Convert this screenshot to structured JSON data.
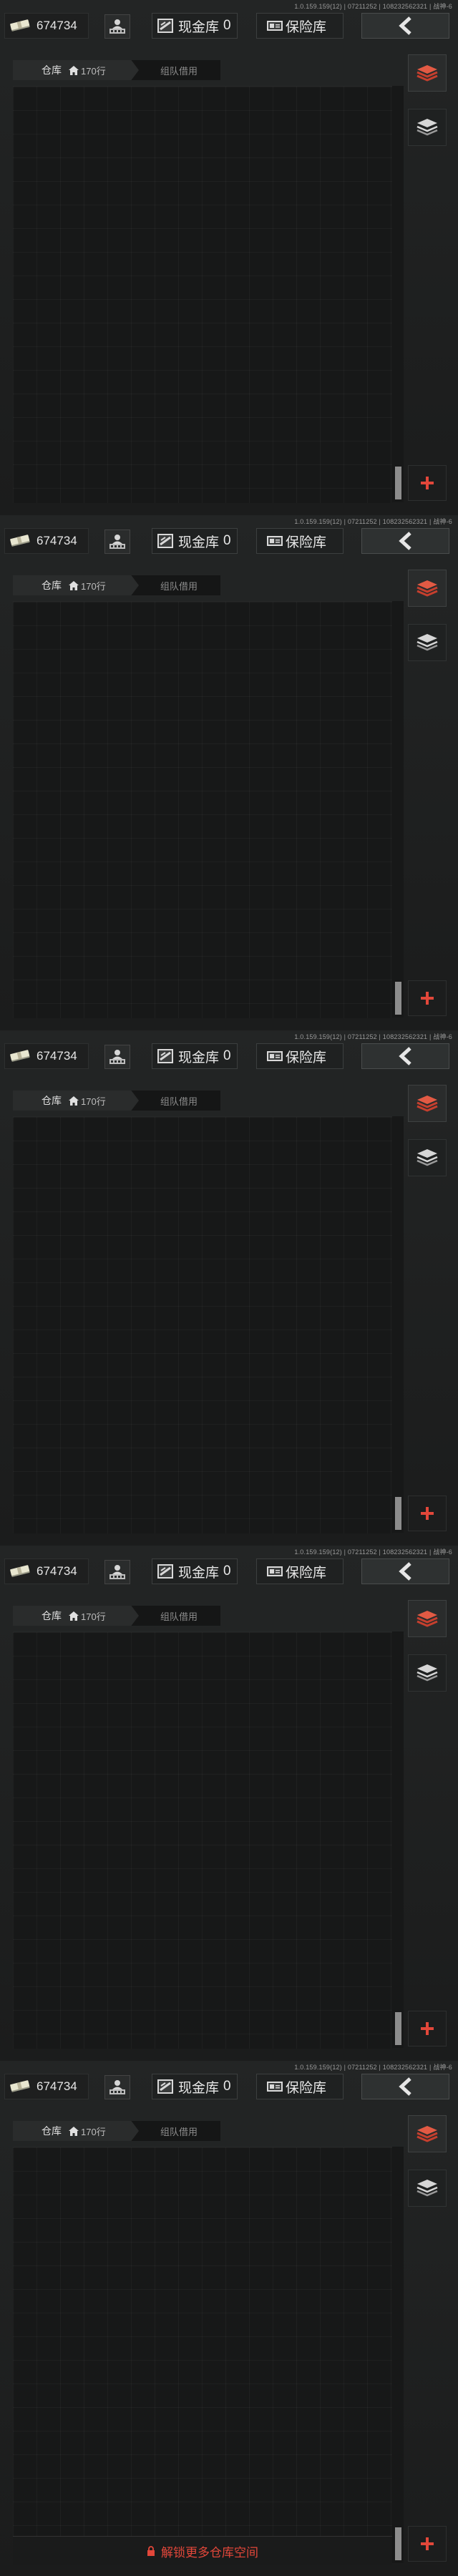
{
  "header": {
    "version": "1.0.159.159(12) | 07211252 | 108232562321 | 战神-6",
    "currency_amount": "674734",
    "cash_label": "现金库",
    "cash_count": "0",
    "safe_label": "保险库"
  },
  "tabs": {
    "warehouse_label": "仓库",
    "warehouse_rows": "170行",
    "team_label": "组队借用"
  },
  "unlock": {
    "label": "解锁更多仓库空间"
  },
  "icons": {
    "currency": "cash-bundle-icon",
    "market": "vendor-shop-icon",
    "cash": "cash-box-icon",
    "safe": "safe-box-icon",
    "back": "chevron-left-icon",
    "stack_red": "red-stack-icon",
    "stack_white": "stack-icon",
    "add": "plus-icon",
    "house": "house-icon",
    "lock": "lock-icon"
  },
  "colors": {
    "accent_red": "#e2473a",
    "text_light": "#e6e6e6",
    "text_muted": "#8c8c8c"
  },
  "panels": [
    {
      "show_unlock": false
    },
    {
      "show_unlock": false
    },
    {
      "show_unlock": false
    },
    {
      "show_unlock": false
    },
    {
      "show_unlock": true
    }
  ]
}
